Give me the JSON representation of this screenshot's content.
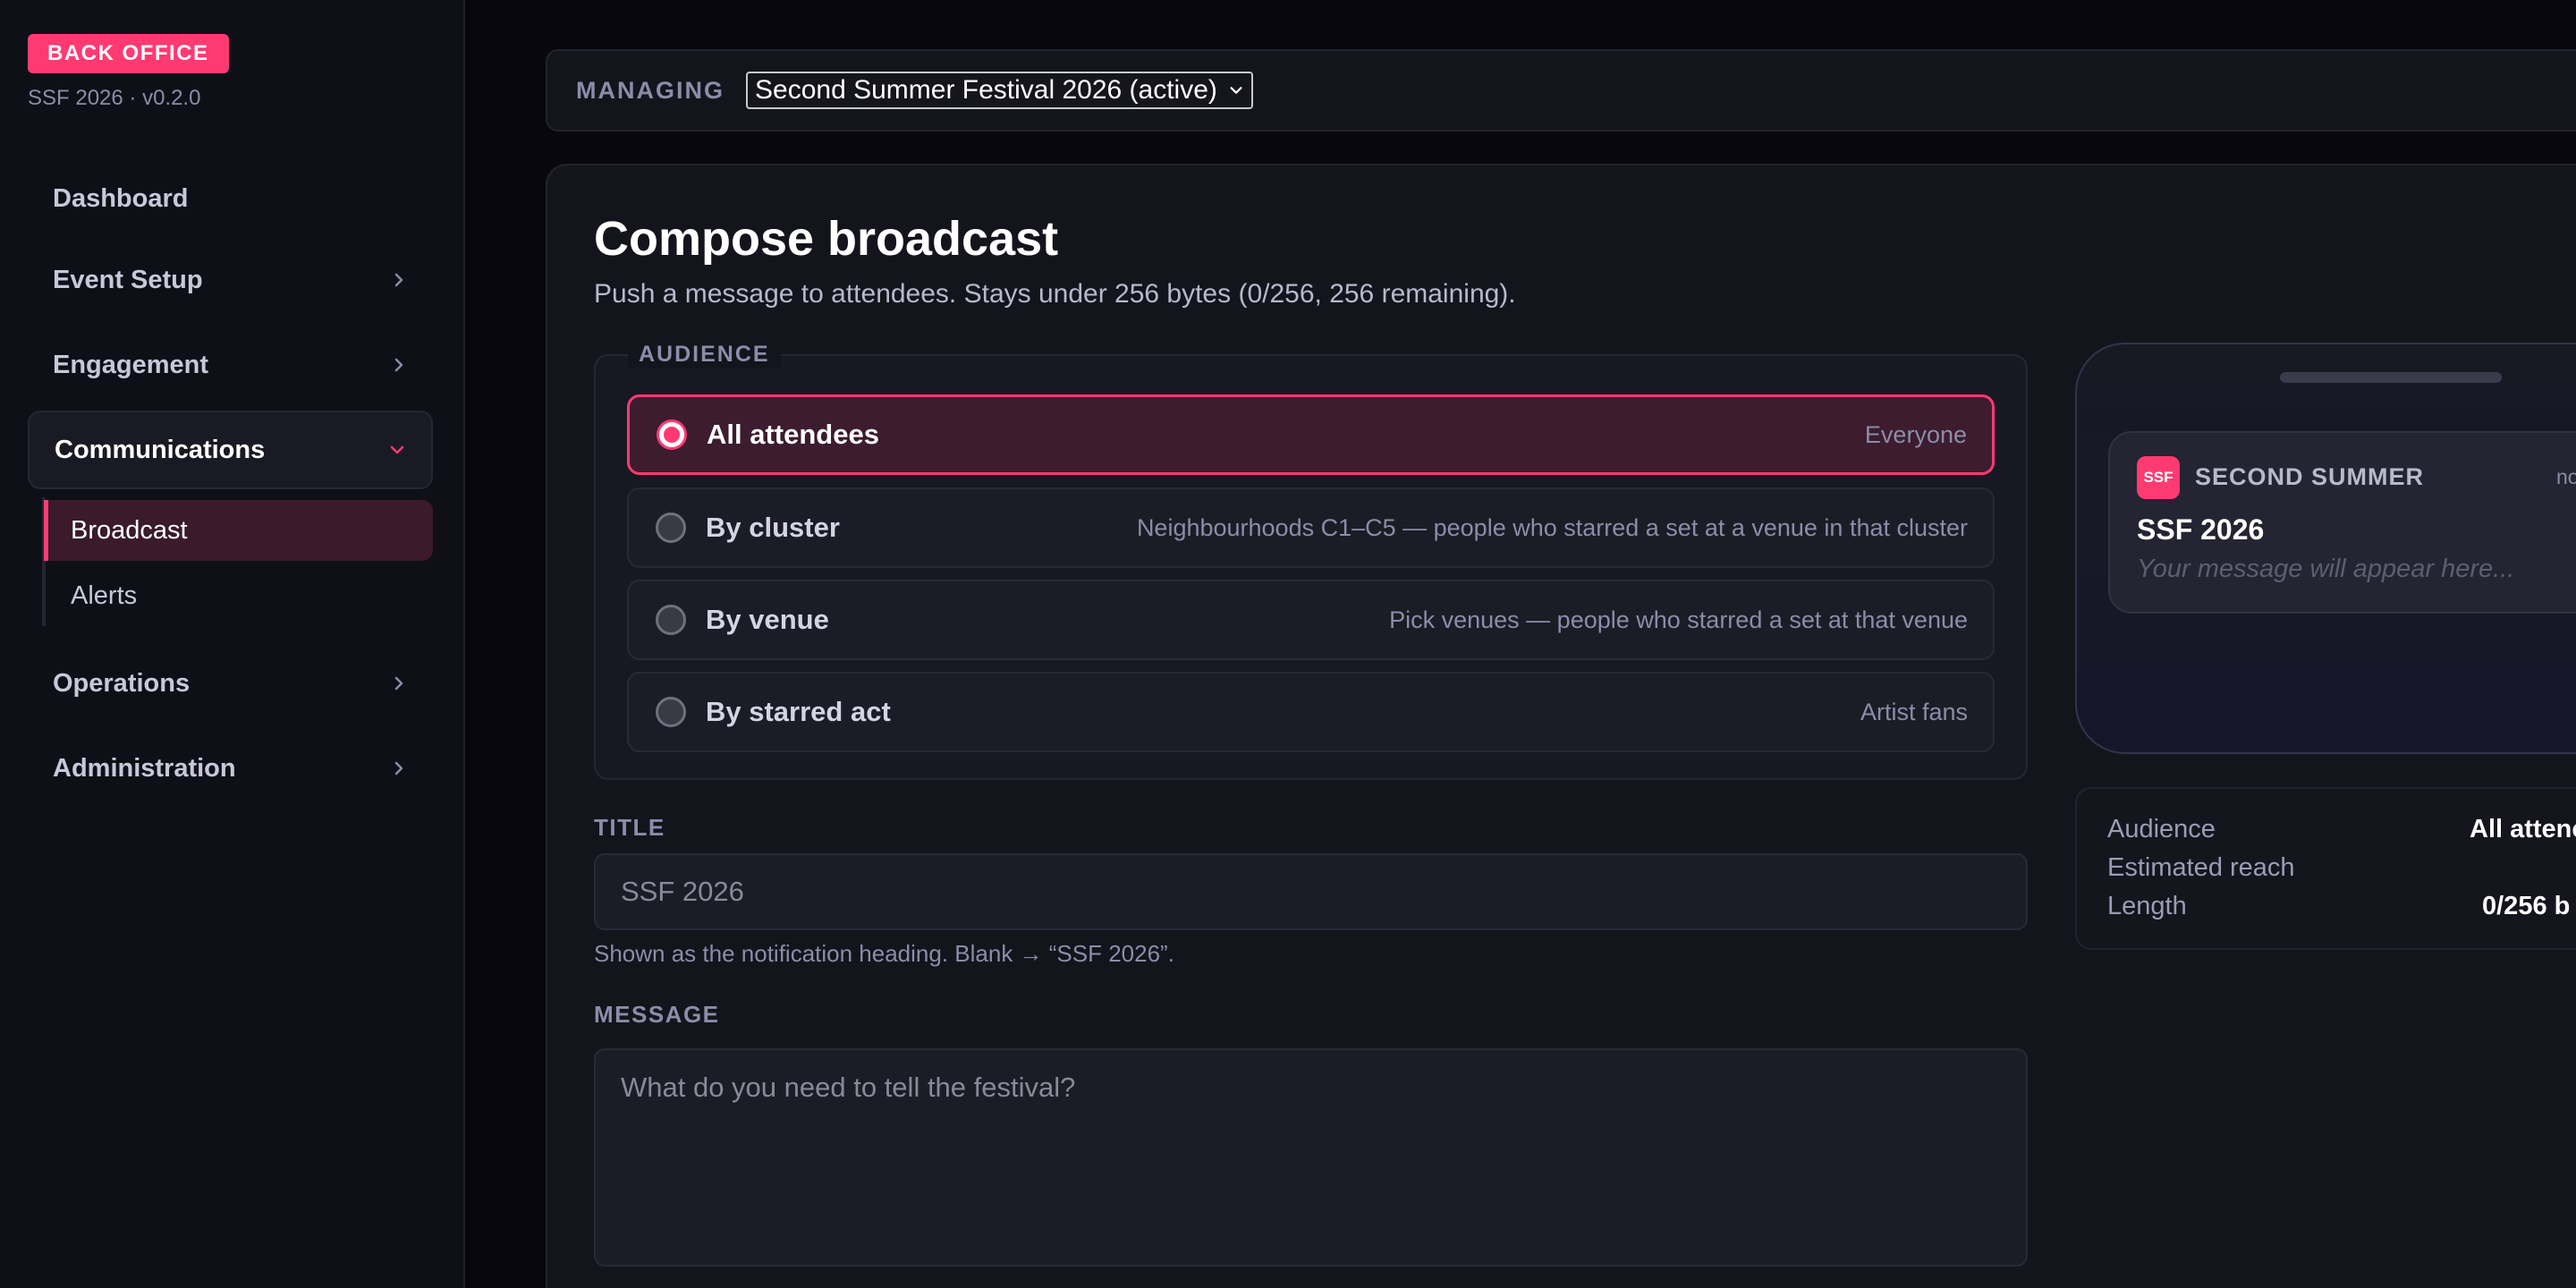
{
  "sidebar": {
    "badge": "BACK OFFICE",
    "version": "SSF 2026 · v0.2.0",
    "items": [
      {
        "label": "Dashboard"
      },
      {
        "label": "Event Setup"
      },
      {
        "label": "Engagement"
      },
      {
        "label": "Communications"
      },
      {
        "label": "Operations"
      },
      {
        "label": "Administration"
      }
    ],
    "subitems": [
      {
        "label": "Broadcast"
      },
      {
        "label": "Alerts"
      }
    ]
  },
  "managing": {
    "label": "MANAGING",
    "selected": "Second Summer Festival 2026 (active)"
  },
  "compose": {
    "title": "Compose broadcast",
    "subtitle": "Push a message to attendees. Stays under 256 bytes (0/256, 256 remaining).",
    "audience_legend": "AUDIENCE",
    "options": [
      {
        "label": "All attendees",
        "desc": "Everyone"
      },
      {
        "label": "By cluster",
        "desc": "Neighbourhoods C1–C5 — people who starred a set at a venue in that cluster"
      },
      {
        "label": "By venue",
        "desc": "Pick venues — people who starred a set at that venue"
      },
      {
        "label": "By starred act",
        "desc": "Artist fans"
      }
    ],
    "title_label": "TITLE",
    "title_placeholder": "SSF 2026",
    "title_hint": "Shown as the notification heading. Blank → “SSF 2026”.",
    "message_label": "MESSAGE",
    "message_placeholder": "What do you need to tell the festival?"
  },
  "preview": {
    "app_icon": "SSF",
    "app_name": "SECOND SUMMER",
    "time": "no",
    "title": "SSF 2026",
    "body": "Your message will appear here..."
  },
  "summary": {
    "rows": [
      {
        "label": "Audience",
        "value": "All attenc"
      },
      {
        "label": "Estimated reach",
        "value": ""
      },
      {
        "label": "Length",
        "value": "0/256 b"
      }
    ]
  },
  "colors": {
    "accent": "#ff3a72",
    "background": "#07070d",
    "sidebar": "#0f0f17",
    "panel": "#14141d"
  }
}
